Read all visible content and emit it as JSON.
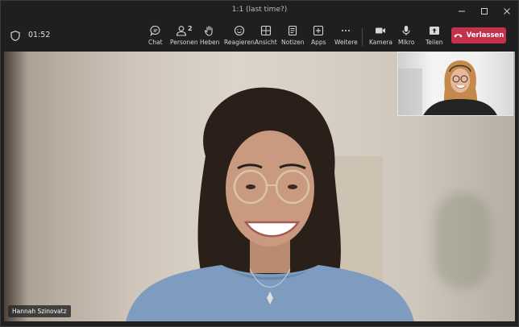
{
  "window": {
    "title": "1:1 (last time?)"
  },
  "call": {
    "timer": "01:52"
  },
  "toolbar": {
    "chat": "Chat",
    "people": "Personen",
    "people_count": "2",
    "raise": "Heben",
    "react": "Reagieren",
    "view": "Ansicht",
    "notes": "Notizen",
    "apps": "Apps",
    "more": "Weitere",
    "camera": "Kamera",
    "mic": "Mikro",
    "share": "Teilen",
    "leave": "Verlassen"
  },
  "stage": {
    "participant_name": "Hannah Szinovatz"
  },
  "colors": {
    "leave": "#c4314b",
    "background": "#1f1f1f"
  },
  "icons": [
    "shield-icon",
    "chat-icon",
    "people-icon",
    "hand-icon",
    "smiley-icon",
    "grid-icon",
    "notes-icon",
    "plus-square-icon",
    "more-icon",
    "camera-icon",
    "mic-icon",
    "share-icon",
    "phone-hangup-icon",
    "minimize-icon",
    "maximize-icon",
    "close-icon"
  ]
}
